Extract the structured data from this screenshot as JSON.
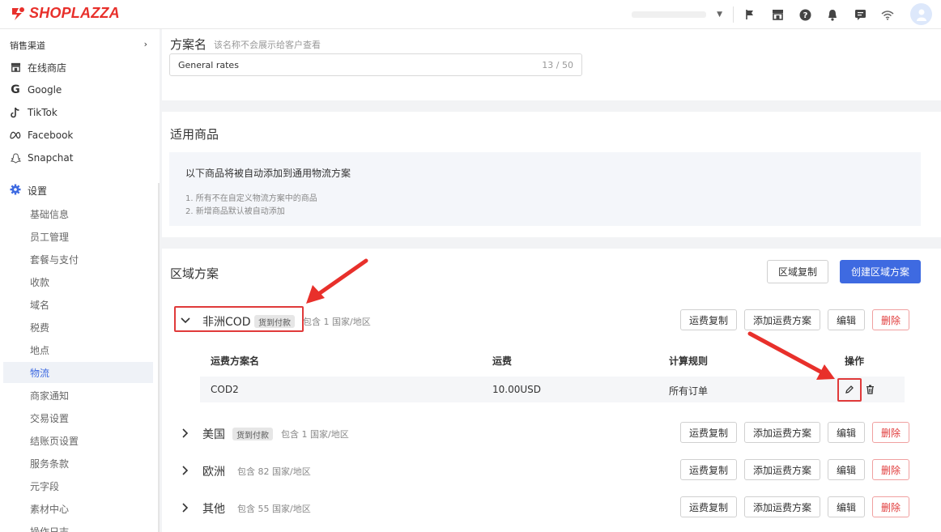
{
  "header": {
    "brand": "SHOPLAZZA",
    "icons": [
      "flag-icon",
      "store-icon",
      "help-icon",
      "bell-icon",
      "message-icon",
      "wifi-icon",
      "avatar-icon"
    ]
  },
  "sidebar": {
    "section_title": "销售渠道",
    "channels": [
      {
        "label": "在线商店",
        "icon": "store-icon"
      },
      {
        "label": "Google",
        "icon": "google-icon"
      },
      {
        "label": "TikTok",
        "icon": "tiktok-icon"
      },
      {
        "label": "Facebook",
        "icon": "meta-icon"
      },
      {
        "label": "Snapchat",
        "icon": "snapchat-icon"
      }
    ],
    "settings_title": "设置",
    "settings_items": [
      "基础信息",
      "员工管理",
      "套餐与支付",
      "收款",
      "域名",
      "税费",
      "地点",
      "物流",
      "商家通知",
      "交易设置",
      "结账页设置",
      "服务条款",
      "元字段",
      "素材中心",
      "操作日志"
    ],
    "active_item": "物流"
  },
  "plan": {
    "title": "方案名",
    "hint": "该名称不会展示给客户查看",
    "value": "General rates",
    "counter": "13 / 50"
  },
  "goods": {
    "title": "适用商品",
    "main": "以下商品将被自动添加到通用物流方案",
    "lines": [
      "1. 所有不在自定义物流方案中的商品",
      "2. 新增商品默认被自动添加"
    ]
  },
  "region": {
    "title": "区域方案",
    "copy_button": "区域复制",
    "create_button": "创建区域方案",
    "row_buttons": {
      "copy": "运费复制",
      "add": "添加运费方案",
      "edit": "编辑",
      "delete": "删除"
    },
    "table_headers": {
      "name": "运费方案名",
      "fee": "运费",
      "rule": "计算规则",
      "action": "操作"
    },
    "zones": [
      {
        "name": "非洲COD",
        "badge": "货到付款",
        "meta": "包含 1 国家/地区",
        "expanded": true,
        "rates": [
          {
            "name": "COD2",
            "fee": "10.00USD",
            "rule": "所有订单"
          }
        ]
      },
      {
        "name": "美国",
        "badge": "货到付款",
        "meta": "包含 1 国家/地区",
        "expanded": false
      },
      {
        "name": "欧洲",
        "badge": "",
        "meta": "包含 82 国家/地区",
        "expanded": false
      },
      {
        "name": "其他",
        "badge": "",
        "meta": "包含 55 国家/地区",
        "expanded": false
      }
    ]
  },
  "colors": {
    "accent": "#3e6ae1",
    "brand": "#e8302b",
    "danger": "#e03a3a"
  }
}
